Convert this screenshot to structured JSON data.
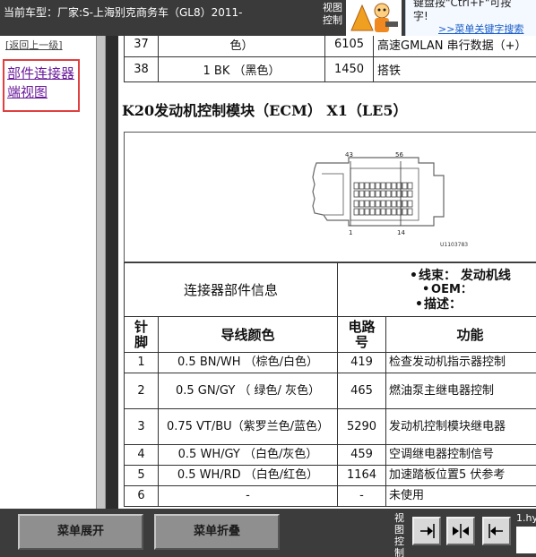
{
  "header": {
    "vehicle_title": "当前车型：厂家:S-上海别克商务车（GL8）2011-",
    "view_control_label": "视图控制",
    "hint_line1": "键盘按\"Ctrl+F\"可按",
    "hint_line2": "字!",
    "hint_link": ">>菜单关键字搜索"
  },
  "sidebar": {
    "back_link": "[返回上一级]",
    "section_link": "部件连接器端视图"
  },
  "top_table": {
    "rows": [
      {
        "pin": "37",
        "color": "色）",
        "circuit": "6105",
        "function": "高速GMLAN 串行数据（+）"
      },
      {
        "pin": "38",
        "color": "1 BK （黑色）",
        "circuit": "1450",
        "function": "搭铁"
      }
    ]
  },
  "connector": {
    "title": "K20发动机控制模块（ECM） X1（LE5）",
    "diagram": {
      "pin_label_43": "43",
      "pin_label_56": "56",
      "pin_label_1": "1",
      "pin_label_14": "14",
      "figure_id": "U1103783"
    },
    "info_header": "连接器部件信息",
    "info_items": [
      {
        "key": "线束：",
        "value": "发动机线"
      },
      {
        "key": "OEM：",
        "value": ""
      },
      {
        "key": "描述：",
        "value": ""
      }
    ],
    "columns": {
      "pin": "针脚",
      "wire_color": "导线颜色",
      "circuit": "电路号",
      "function": "功能"
    },
    "rows": [
      {
        "pin": "1",
        "color": "0.5 BN/WH （棕色/白色）",
        "circuit": "419",
        "function": "检查发动机指示器控制"
      },
      {
        "pin": "2",
        "color": "0.5 GN/GY （ 绿色/ 灰色）",
        "circuit": "465",
        "function": "燃油泵主继电器控制"
      },
      {
        "pin": "3",
        "color": "0.75 VT/BU（紫罗兰色/蓝色）",
        "circuit": "5290",
        "function": "发动机控制模块继电器"
      },
      {
        "pin": "4",
        "color": "0.5 WH/GY （白色/灰色）",
        "circuit": "459",
        "function": "空调继电器控制信号"
      },
      {
        "pin": "5",
        "color": "0.5 WH/RD （白色/红色）",
        "circuit": "1164",
        "function": "加速踏板位置5 伏参考"
      },
      {
        "pin": "6",
        "color": "-",
        "circuit": "-",
        "function": "未使用"
      }
    ]
  },
  "footer": {
    "expand_label": "菜单展开",
    "collapse_label": "菜单折叠",
    "view_control_label": "视图控制",
    "file_label": "1.hy"
  },
  "colors": {
    "dark_bar": "#3c3c3c",
    "sidebar_link": "#6a1a9a",
    "highlight_border": "#e04040"
  }
}
